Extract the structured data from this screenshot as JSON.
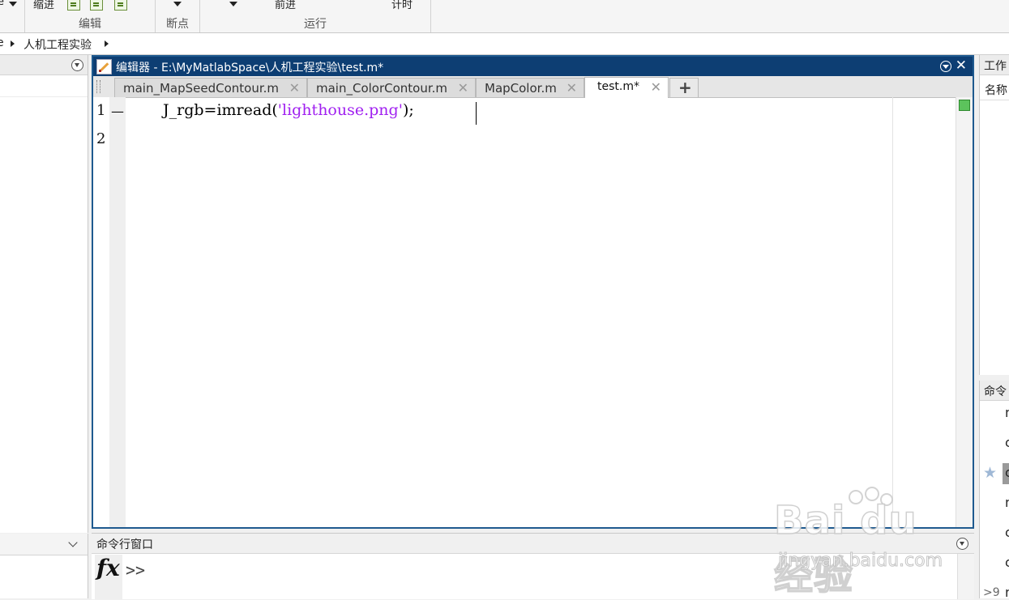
{
  "toolstrip": {
    "partial_left": "e",
    "indent_label": "缩进",
    "edit_group": "编辑",
    "breakpoint_group": "断点",
    "advance_label": "前进",
    "timing_label": "计时",
    "run_group": "运行"
  },
  "address": {
    "path": [
      "e",
      "人机工程实验"
    ]
  },
  "editor": {
    "title": "编辑器 - E:\\MyMatlabSpace\\人机工程实验\\test.m*",
    "tabs": [
      {
        "label": "main_MapSeedContour.m",
        "active": false
      },
      {
        "label": "main_ColorContour.m",
        "active": false
      },
      {
        "label": "MapColor.m",
        "active": false
      },
      {
        "label": "test.m*",
        "active": true
      }
    ],
    "add_tab": "+",
    "close_glyph": "✕",
    "lines": [
      {
        "num": "1",
        "marker": "—",
        "code_prefix": "J_rgb=imread(",
        "code_string": "'lighthouse.png'",
        "code_suffix": ");"
      },
      {
        "num": "2",
        "marker": "",
        "code_prefix": "",
        "code_string": "",
        "code_suffix": ""
      }
    ],
    "status_color": "#5cc35c"
  },
  "command_window": {
    "title": "命令行窗口",
    "fx": "fx",
    "prompt": ">>"
  },
  "workspace": {
    "title_partial": "工作",
    "name_column": "名称"
  },
  "history": {
    "title_partial": "命令",
    "items": [
      "n",
      "c",
      "c",
      "n",
      "c",
      "c",
      "n"
    ],
    "selected_index": 2,
    "star": "★",
    "more_label": ">9"
  },
  "watermark": {
    "brand": "Bai du 经验",
    "url": "jingyan.baidu.com"
  },
  "colors": {
    "editor_title_bg": "#0d3e73",
    "editor_border": "#1f5a8f",
    "string_color": "#a020f0"
  }
}
